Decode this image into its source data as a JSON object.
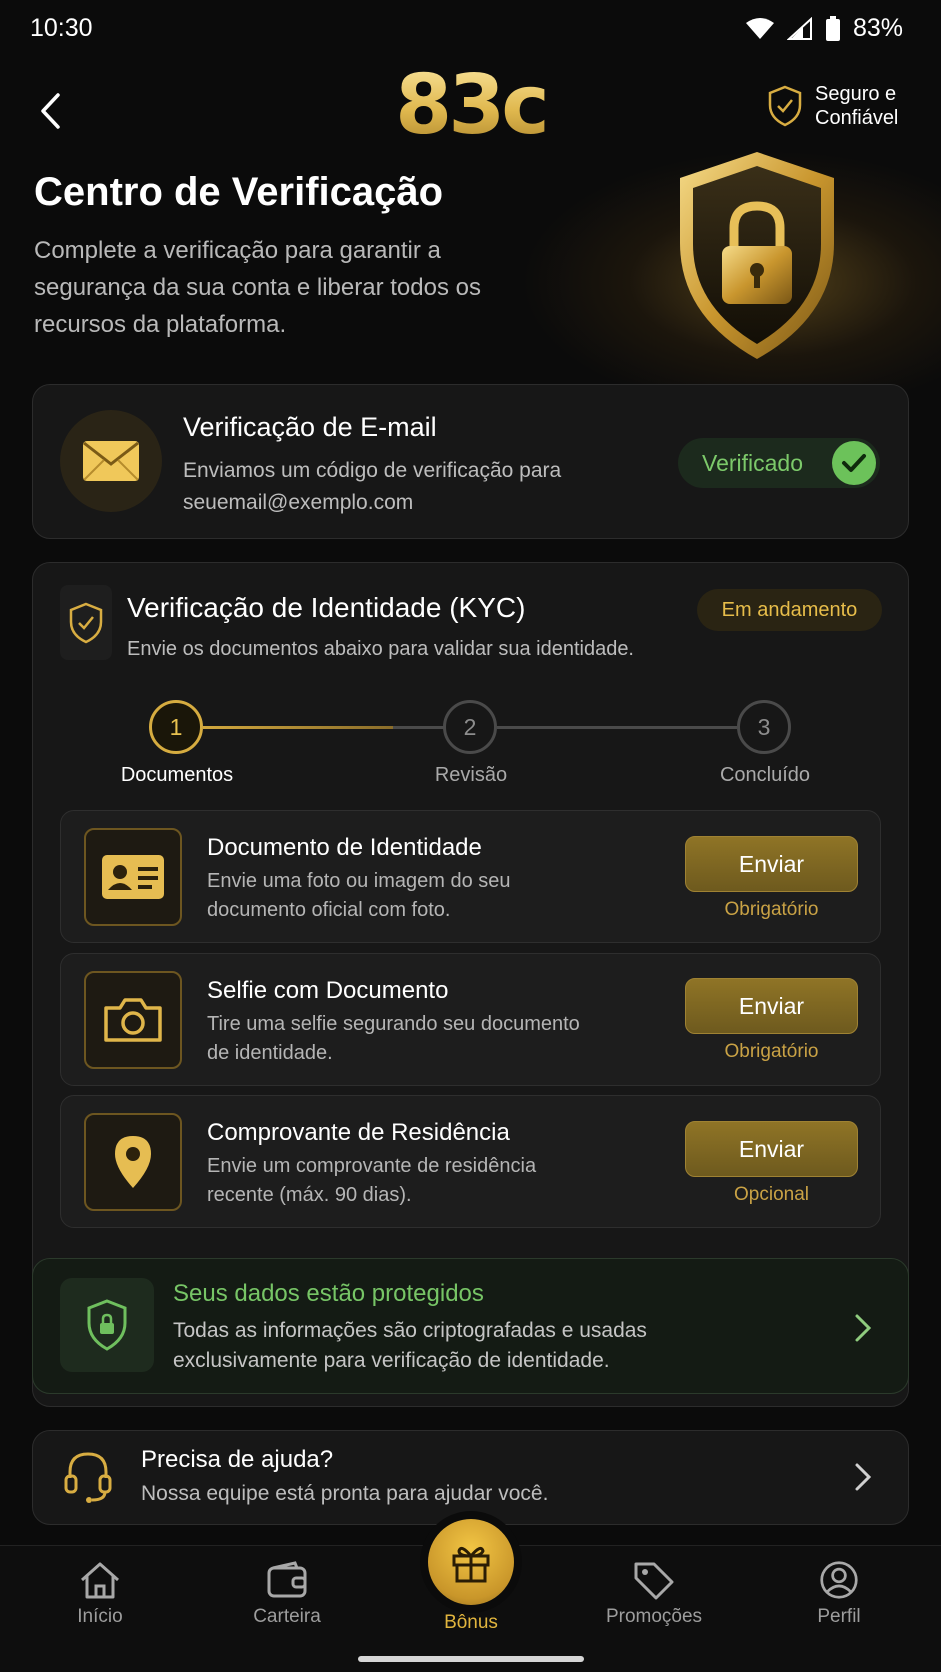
{
  "status_bar": {
    "time": "10:30",
    "battery": "83%"
  },
  "header": {
    "logo": "83c",
    "trust_label": "Seguro e Confiável"
  },
  "page": {
    "title": "Centro de Verificação",
    "subtitle": "Complete a verificação para garantir a segurança da sua conta e liberar todos os recursos da plataforma."
  },
  "email_verification": {
    "title": "Verificação de E-mail",
    "description": "Enviamos um código de verificação para seuemail@exemplo.com",
    "status": "Verificado",
    "status_color": "#7cc96a"
  },
  "kyc": {
    "title": "Verificação de Identidade (KYC)",
    "description": "Envie os documentos abaixo para validar sua identidade.",
    "status": "Em andamento",
    "steps": [
      {
        "number": "1",
        "label": "Documentos",
        "state": "active"
      },
      {
        "number": "2",
        "label": "Revisão",
        "state": "pending"
      },
      {
        "number": "3",
        "label": "Concluído",
        "state": "pending"
      }
    ],
    "documents": [
      {
        "icon": "id-card-icon",
        "title": "Documento de Identidade",
        "description": "Envie uma foto ou imagem do seu documento oficial com foto.",
        "button": "Enviar",
        "requirement": "Obrigatório"
      },
      {
        "icon": "camera-icon",
        "title": "Selfie com Documento",
        "description": "Tire uma selfie segurando seu documento de identidade.",
        "button": "Enviar",
        "requirement": "Obrigatório"
      },
      {
        "icon": "location-pin-icon",
        "title": "Comprovante de Residência",
        "description": "Envie um comprovante de residência recente (máx. 90 dias).",
        "button": "Enviar",
        "requirement": "Opcional"
      }
    ]
  },
  "protection": {
    "title": "Seus dados estão protegidos",
    "description": "Todas as informações são criptografadas e usadas exclusivamente para verificação de identidade."
  },
  "help": {
    "title": "Precisa de ajuda?",
    "description": "Nossa equipe está pronta para ajudar você."
  },
  "bottom_nav": {
    "items": [
      {
        "label": "Início",
        "icon": "home-icon"
      },
      {
        "label": "Carteira",
        "icon": "wallet-icon"
      },
      {
        "label": "Bônus",
        "icon": "gift-icon",
        "active": true
      },
      {
        "label": "Promoções",
        "icon": "tag-icon"
      },
      {
        "label": "Perfil",
        "icon": "user-icon"
      }
    ]
  },
  "colors": {
    "accent_gold": "#e1b53e",
    "success_green": "#77c566",
    "background": "#0b0b0b"
  }
}
